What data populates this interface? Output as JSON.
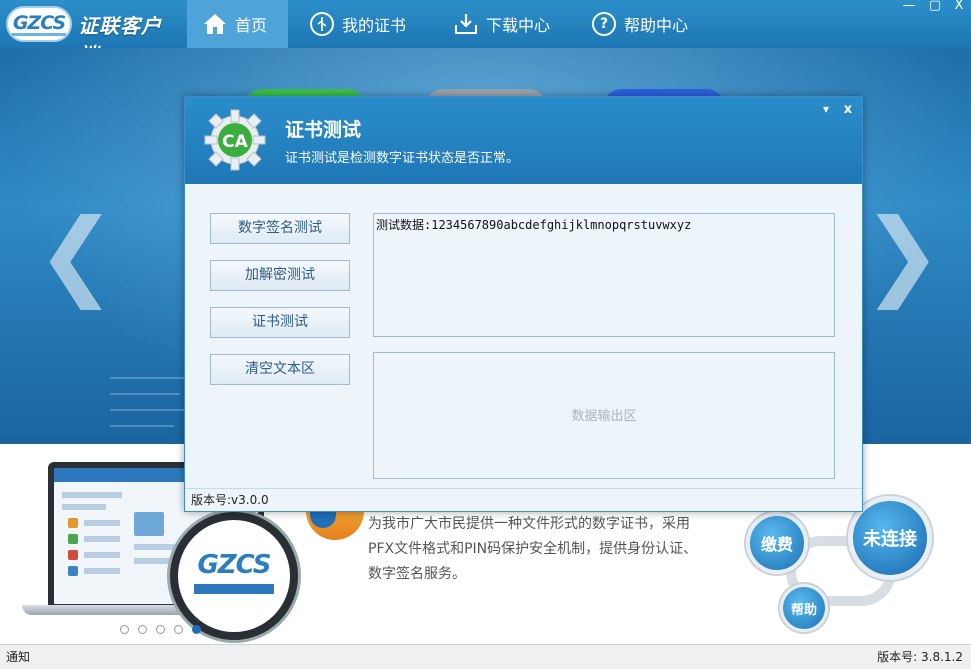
{
  "app": {
    "logo_mark": "GZCS",
    "logo_text": "证联客户端"
  },
  "nav": [
    {
      "label": "首页",
      "icon": "home-icon",
      "active": true
    },
    {
      "label": "我的证书",
      "icon": "usb-key-icon",
      "active": false
    },
    {
      "label": "下载中心",
      "icon": "download-icon",
      "active": false
    },
    {
      "label": "帮助中心",
      "icon": "help-icon",
      "active": false
    }
  ],
  "window_controls": {
    "minimize": "—",
    "maximize": "▢",
    "close": "X"
  },
  "banner": {
    "prev_arrow": "❮",
    "next_arrow": "❯"
  },
  "dialog": {
    "title": "证书测试",
    "subtitle": "证书测试是检测数字证书状态是否正常。",
    "icon_label": "CA",
    "minimize": "▾",
    "close": "x",
    "buttons": {
      "sign_test": "数字签名测试",
      "crypto_test": "加解密测试",
      "cert_test": "证书测试",
      "clear_text": "清空文本区"
    },
    "input_text": "测试数据:1234567890abcdefghijklmnopqrstuvwxyz",
    "output_placeholder": "数据输出区",
    "version": "版本号:v3.0.0"
  },
  "lower": {
    "lens_logo": "GZCS",
    "description": "为我市广大市民提供一种文件形式的数字证书，采用PFX文件格式和PIN码保护安全机制，提供身份认证、数字签名服务。",
    "carousel_active_index": 4,
    "pay_label": "缴费",
    "connect_label": "未连接",
    "help_label": "帮助"
  },
  "status": {
    "left": "通知",
    "right": "版本号: 3.8.1.2"
  },
  "colors": {
    "brand_blue": "#1f77b6",
    "nav_active": "#4ea4d8",
    "pill_green": "#3cbf4a",
    "pill_gray": "#9aa6ad",
    "pill_blue": "#2b5fe0"
  }
}
